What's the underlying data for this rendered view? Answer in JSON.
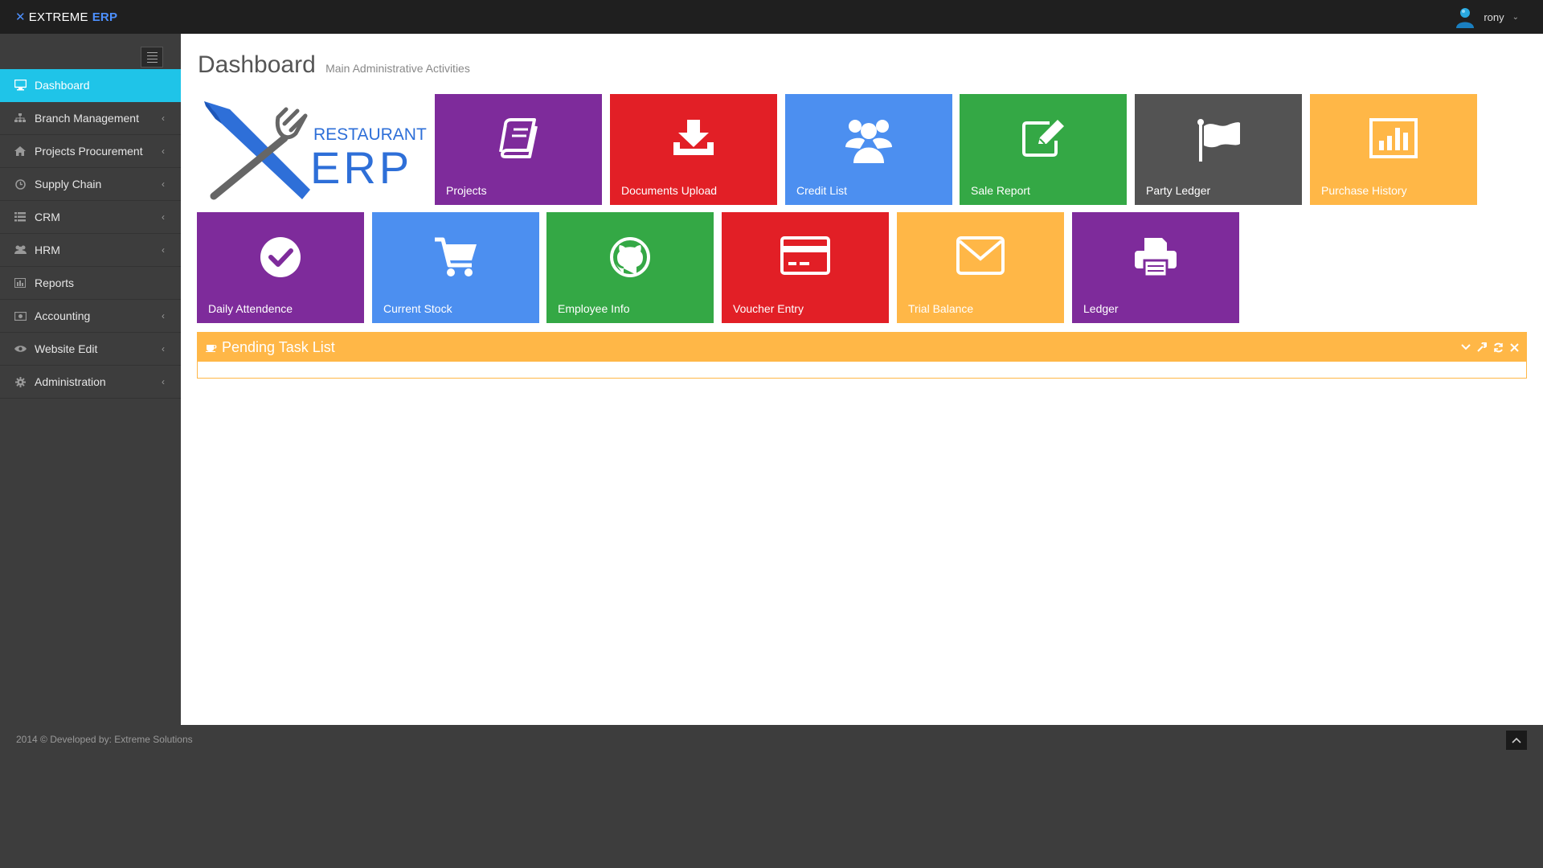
{
  "brand": {
    "prefix": "EXTREME",
    "suffix": "ERP",
    "icon": "brand-x-icon"
  },
  "user": {
    "name": "rony",
    "avatar_icon": "user-avatar-icon"
  },
  "sidebar": {
    "items": [
      {
        "label": "Dashboard",
        "icon": "desktop-icon",
        "active": true,
        "has_arrow": false
      },
      {
        "label": "Branch Management",
        "icon": "sitemap-icon",
        "has_arrow": true
      },
      {
        "label": "Projects Procurement",
        "icon": "home-icon",
        "has_arrow": true
      },
      {
        "label": "Supply Chain",
        "icon": "clock-icon",
        "has_arrow": true
      },
      {
        "label": "CRM",
        "icon": "list-icon",
        "has_arrow": true
      },
      {
        "label": "HRM",
        "icon": "users-icon",
        "has_arrow": true
      },
      {
        "label": "Reports",
        "icon": "bar-chart-icon",
        "has_arrow": false
      },
      {
        "label": "Accounting",
        "icon": "money-icon",
        "has_arrow": true
      },
      {
        "label": "Website Edit",
        "icon": "eye-icon",
        "has_arrow": true
      },
      {
        "label": "Administration",
        "icon": "cog-icon",
        "has_arrow": true
      }
    ],
    "arrow": "‹"
  },
  "main": {
    "title": "Dashboard",
    "subtitle": "Main Administrative Activities",
    "logo": {
      "line1": "RESTAURANT",
      "line2": "ERP"
    },
    "tiles": [
      {
        "label": "Projects",
        "icon": "book-icon",
        "color": "#7e2b9b"
      },
      {
        "label": "Documents Upload",
        "icon": "download-icon",
        "color": "#e21f26"
      },
      {
        "label": "Credit List",
        "icon": "group-icon",
        "color": "#4c8ff0"
      },
      {
        "label": "Sale Report",
        "icon": "edit-icon",
        "color": "#34a845"
      },
      {
        "label": "Party Ledger",
        "icon": "flag-icon",
        "color": "#535353"
      },
      {
        "label": "Purchase History",
        "icon": "bar-chart-icon",
        "color": "#ffb747"
      },
      {
        "label": "Daily Attendence",
        "icon": "check-circle-icon",
        "color": "#7e2b9b"
      },
      {
        "label": "Current Stock",
        "icon": "cart-icon",
        "color": "#4c8ff0"
      },
      {
        "label": "Employee Info",
        "icon": "github-icon",
        "color": "#34a845"
      },
      {
        "label": "Voucher Entry",
        "icon": "credit-card-icon",
        "color": "#e21f26"
      },
      {
        "label": "Trial Balance",
        "icon": "envelope-icon",
        "color": "#ffb747"
      },
      {
        "label": "Ledger",
        "icon": "print-icon",
        "color": "#7e2b9b"
      }
    ]
  },
  "panel": {
    "title": "Pending Task List",
    "icon": "coffee-icon",
    "tools": [
      "chevron-down-icon",
      "wrench-icon",
      "refresh-icon",
      "close-icon"
    ]
  },
  "footer": {
    "text": "2014 © Developed by: Extreme Solutions",
    "scroll_top_icon": "chevron-up-icon"
  }
}
